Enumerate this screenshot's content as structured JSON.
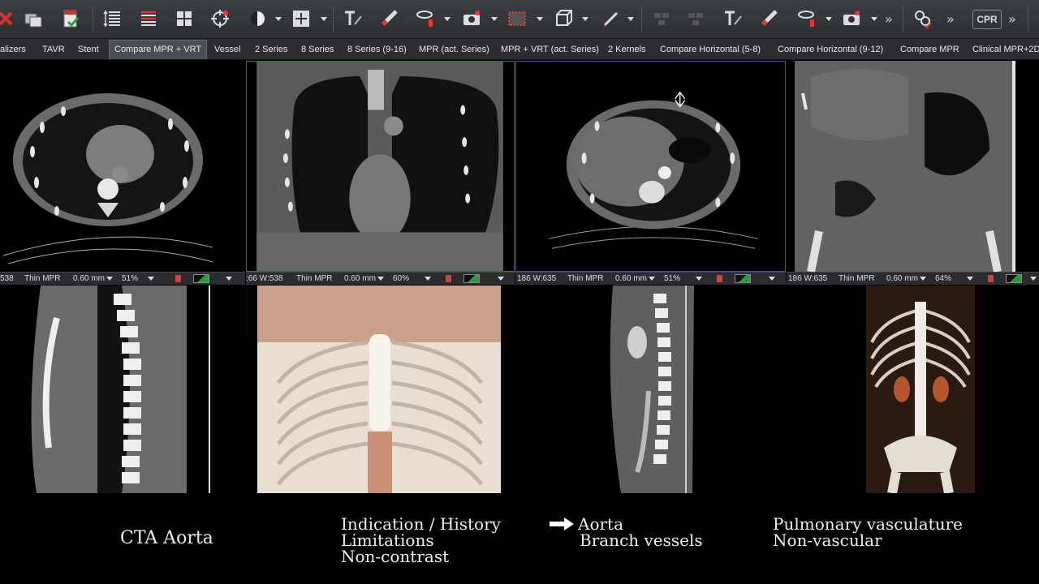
{
  "toolbar": {
    "cpr_label": "CPR",
    "icons": [
      "close-icon",
      "folder-icon",
      "save-check-icon",
      "stack-icon",
      "stack-color-icon",
      "layout-grid-icon",
      "crosshair-icon",
      "contrast-icon",
      "zoom-fit-icon",
      "text-annotation-icon",
      "ruler-icon",
      "roi-ellipse-icon",
      "camera-icon",
      "grid-select-icon",
      "cube-icon",
      "pen-icon",
      "text-annotation-icon",
      "ruler-icon",
      "roi-ellipse-icon",
      "camera-icon",
      "link-check-icon"
    ]
  },
  "tabs": [
    {
      "label": "alizers"
    },
    {
      "label": "TAVR"
    },
    {
      "label": "Stent"
    },
    {
      "label": "Compare MPR + VRT",
      "active": true
    },
    {
      "label": "Vessel"
    },
    {
      "label": "2 Series"
    },
    {
      "label": "8 Series"
    },
    {
      "label": "8 Series (9-16)"
    },
    {
      "label": "MPR (act. Series)"
    },
    {
      "label": "MPR + VRT (act. Series)"
    },
    {
      "label": "2 Kernels"
    },
    {
      "label": "Compare Horizontal (5-8)"
    },
    {
      "label": "Compare Horizontal (9-12)"
    },
    {
      "label": "Compare MPR"
    },
    {
      "label": "Clinical MPR+2D"
    }
  ],
  "viewport_bars": [
    {
      "window": "538",
      "mode": "Thin MPR",
      "thickness": "0.60 mm",
      "zoom": "51%"
    },
    {
      "window": ":66 W:538",
      "mode": "Thin MPR",
      "thickness": "0.60 mm",
      "zoom": "60%"
    },
    {
      "window": "186 W:635",
      "mode": "Thin MPR",
      "thickness": "0.60 mm",
      "zoom": "51%"
    },
    {
      "window": "186 W:635",
      "mode": "Thin MPR",
      "thickness": "0.60 mm",
      "zoom": "64%"
    }
  ],
  "captions": {
    "title": "CTA Aorta",
    "col2": [
      "Indication / History",
      "Limitations",
      "Non-contrast"
    ],
    "col3": [
      "Aorta",
      "Branch vessels"
    ],
    "col4": [
      "Pulmonary vasculature",
      "Non-vascular"
    ]
  },
  "colors": {
    "accent_green": "#2d9b3a",
    "viewport_border_blue": "#3a4fb8",
    "viewport_border_green": "#2f7a3a"
  }
}
